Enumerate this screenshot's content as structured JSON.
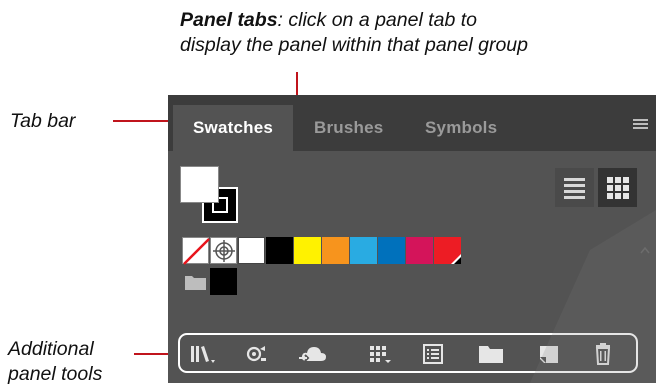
{
  "annotations": {
    "panel_tabs": {
      "title": "Panel tabs",
      "line1_rest": ": click on a panel tab to",
      "line2": "display the panel within that panel group"
    },
    "tab_bar": "Tab bar",
    "additional_tools": {
      "line1": "Additional",
      "line2": "panel tools"
    },
    "leader_color": "#c0141c"
  },
  "panel": {
    "tabs": [
      {
        "label": "Swatches",
        "active": true
      },
      {
        "label": "Brushes",
        "active": false
      },
      {
        "label": "Symbols",
        "active": false
      }
    ],
    "menu_icon": "panel-menu-icon",
    "view_buttons": [
      "list-view-icon",
      "thumbnail-view-icon"
    ],
    "swatches_row1": [
      "none",
      "registration",
      "#ffffff",
      "#000000",
      "#fff200",
      "#f7941d",
      "#29abe2",
      "#0071bc",
      "#d4145a",
      "#ed1c24"
    ],
    "swatches_row2": [
      "folder",
      "#000000"
    ],
    "tools": [
      "swatch-libraries-icon",
      "show-swatch-kinds-icon",
      "cloud-libraries-icon",
      "swatch-options-grid-icon",
      "swatch-options-icon",
      "new-color-group-icon",
      "new-swatch-icon",
      "delete-swatch-icon"
    ],
    "colors": {
      "panel_bg": "#535353",
      "tabbar_bg": "#3c3c3c",
      "active_tab_text": "#ffffff",
      "inactive_tab_text": "#9a9a9a"
    }
  }
}
